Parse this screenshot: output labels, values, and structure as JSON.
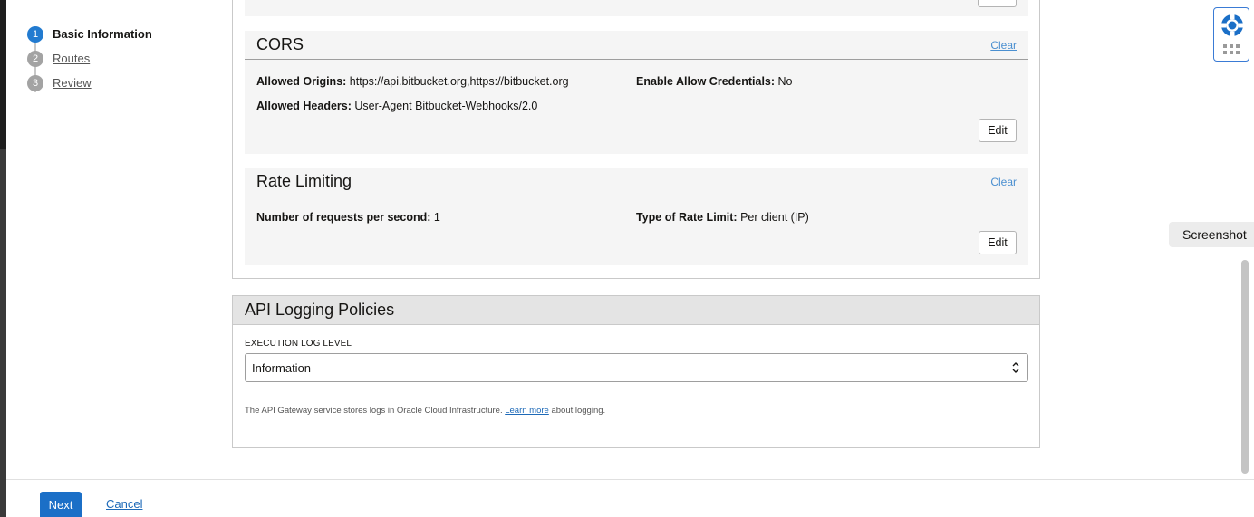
{
  "stepper": {
    "steps": [
      {
        "number": "1",
        "label": "Basic Information",
        "active": true
      },
      {
        "number": "2",
        "label": "Routes",
        "active": false
      },
      {
        "number": "3",
        "label": "Review",
        "active": false
      }
    ]
  },
  "cors": {
    "title": "CORS",
    "clear_label": "Clear",
    "allowed_origins_label": "Allowed Origins:",
    "allowed_origins_value": "https://api.bitbucket.org,https://bitbucket.org",
    "allow_credentials_label": "Enable Allow Credentials:",
    "allow_credentials_value": "No",
    "allowed_headers_label": "Allowed Headers:",
    "allowed_headers_value": "User-Agent Bitbucket-Webhooks/2.0",
    "edit_label": "Edit"
  },
  "rate_limiting": {
    "title": "Rate Limiting",
    "clear_label": "Clear",
    "requests_label": "Number of requests per second:",
    "requests_value": "1",
    "type_label": "Type of Rate Limit:",
    "type_value": "Per client (IP)",
    "edit_label": "Edit"
  },
  "logging": {
    "title": "API Logging Policies",
    "execution_log_label": "EXECUTION LOG LEVEL",
    "execution_log_value": "Information",
    "help_prefix": "The API Gateway service stores logs in Oracle Cloud Infrastructure.",
    "help_link": "Learn more",
    "help_suffix": "about logging."
  },
  "footer": {
    "next_label": "Next",
    "cancel_label": "Cancel"
  },
  "widgets": {
    "screenshot_label": "Screenshot"
  },
  "colors": {
    "accent": "#227bd0",
    "primary_button": "#1b6fc7",
    "link": "#1e6ab8"
  }
}
